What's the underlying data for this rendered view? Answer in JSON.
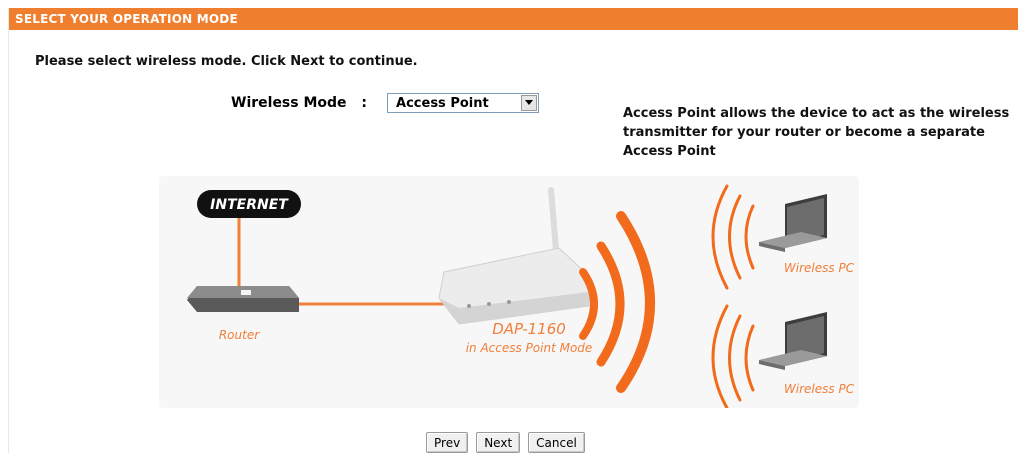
{
  "header": {
    "title": "SELECT YOUR OPERATION MODE"
  },
  "instruction": "Please select wireless mode. Click Next to continue.",
  "wireless_mode": {
    "label": "Wireless Mode",
    "separator": ":",
    "selected": "Access Point"
  },
  "description": {
    "bold_lead": "Access Point",
    "text": " allows the device to act as the wireless transmitter for your router or become a separate Access Point"
  },
  "diagram": {
    "internet_label": "INTERNET",
    "router_label": "Router",
    "device_label_line1": "DAP-1160",
    "device_label_line2": "in Access Point Mode",
    "client1_label": "Wireless PC",
    "client2_label": "Wireless PC"
  },
  "buttons": {
    "prev": "Prev",
    "next": "Next",
    "cancel": "Cancel"
  },
  "colors": {
    "accent": "#ef7f2e",
    "signal": "#f26a1b",
    "label": "#f07f3a"
  },
  "icons": [
    "dropdown-arrow-icon",
    "internet-icon",
    "router-icon",
    "access-point-icon",
    "laptop-icon",
    "signal-waves-icon"
  ]
}
